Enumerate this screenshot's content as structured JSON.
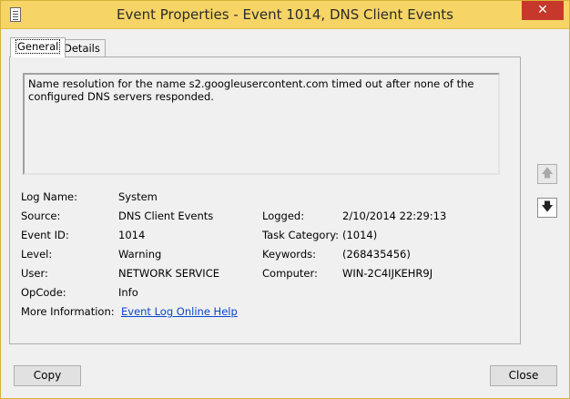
{
  "window": {
    "title": "Event Properties - Event 1014, DNS Client Events",
    "close_glyph": "✕"
  },
  "tabs": [
    {
      "label": "General",
      "active": true
    },
    {
      "label": "Details",
      "active": false
    }
  ],
  "description": "Name resolution for the name s2.googleusercontent.com timed out after none of the configured DNS servers responded.",
  "fields": {
    "log_name": {
      "label": "Log Name:",
      "value": "System"
    },
    "source": {
      "label": "Source:",
      "value": "DNS Client Events"
    },
    "event_id": {
      "label": "Event ID:",
      "value": "1014"
    },
    "level": {
      "label": "Level:",
      "value": "Warning"
    },
    "user": {
      "label": "User:",
      "value": "NETWORK SERVICE"
    },
    "opcode": {
      "label": "OpCode:",
      "value": "Info"
    },
    "more_info": {
      "label": "More Information:",
      "value": "Event Log Online Help"
    },
    "logged": {
      "label": "Logged:",
      "value": "2/10/2014 22:29:13"
    },
    "task_category": {
      "label": "Task Category:",
      "value": "(1014)"
    },
    "keywords": {
      "label": "Keywords:",
      "value": "(268435456)"
    },
    "computer": {
      "label": "Computer:",
      "value": "WIN-2C4IJKEHR9J"
    }
  },
  "nav": {
    "up_icon": "arrow-up-icon",
    "down_icon": "arrow-down-icon",
    "up_glyph": "🡅",
    "down_glyph": "🡇"
  },
  "buttons": {
    "copy": "Copy",
    "close": "Close"
  },
  "colors": {
    "titlebar": "#f6d465",
    "close_button": "#c7372b",
    "link": "#0a46c8"
  }
}
